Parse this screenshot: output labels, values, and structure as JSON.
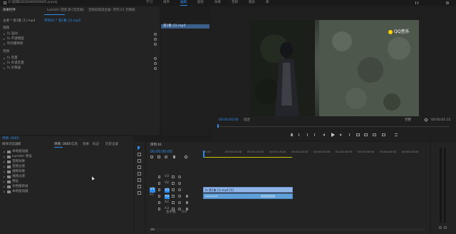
{
  "topbar": {
    "project_path": "E:\\剪辑\\2020\\0000\\0005.prproj",
    "workspaces": [
      "学习",
      "组件",
      "编辑",
      "颜色",
      "效果",
      "音频",
      "图形",
      "库"
    ],
    "active_index": 2
  },
  "effect_controls": {
    "tabs": [
      "效果控件",
      "Lumetri 范围",
      "源:(无剪辑)",
      "音频剪辑混合器: 序列 01",
      "元数据"
    ],
    "header_source": "主要 * 第1集 (1).mp4",
    "header_seq": "序列01 * 第1集 (1).mp4",
    "section_video": "视频",
    "video_items": [
      "fx  运动",
      "fx  不透明度",
      "时间重映射"
    ],
    "section_audio": "音频",
    "audio_items": [
      "fx  音量",
      "fx  声道音量",
      "fx  声像器"
    ]
  },
  "clip_list": {
    "item": "第1集 (1).mp4"
  },
  "program": {
    "watermark": "QQ音乐",
    "timecode_left": "00:00:00:00",
    "fit": "适合",
    "quality": "完整",
    "timecode_right": "00:00:01:15"
  },
  "project_panel": {
    "title": "项目: 0005",
    "tabs": [
      "项目: 0005",
      "媒体浏览器",
      "库",
      "信息",
      "效果",
      "标记",
      "历史记录"
    ],
    "active_tab": 0,
    "folders": [
      "本地驱动器",
      "Lumetri 预设",
      "音频效果",
      "音频过渡",
      "视频效果",
      "视频过渡",
      "预设",
      "文档根目录",
      "本地驱动器"
    ]
  },
  "timeline": {
    "tab": "序列 01",
    "timecode": "00:00:00:00",
    "ruler": [
      "00:00",
      "00:00:05:00",
      "00:00:10:00",
      "00:00:15:00",
      "00:00:20:00",
      "00:00:25:00",
      "00:00:30:00",
      "00:00:35:00",
      "00:00:40:00",
      "00:00:45:00"
    ],
    "tracks": [
      "V3",
      "V2",
      "V1",
      "A1",
      "A2",
      "A3"
    ],
    "master": "主声道",
    "master_value": "0.0",
    "video_clip": "fx 第1集 (1).mp4 [V]",
    "source_label": "V1",
    "source_audio": "A1"
  },
  "colors": {
    "accent": "#2d8ceb",
    "clip_video": "#8fb4e8",
    "clip_audio": "#5fa0d8",
    "workarea": "#c8c800"
  }
}
